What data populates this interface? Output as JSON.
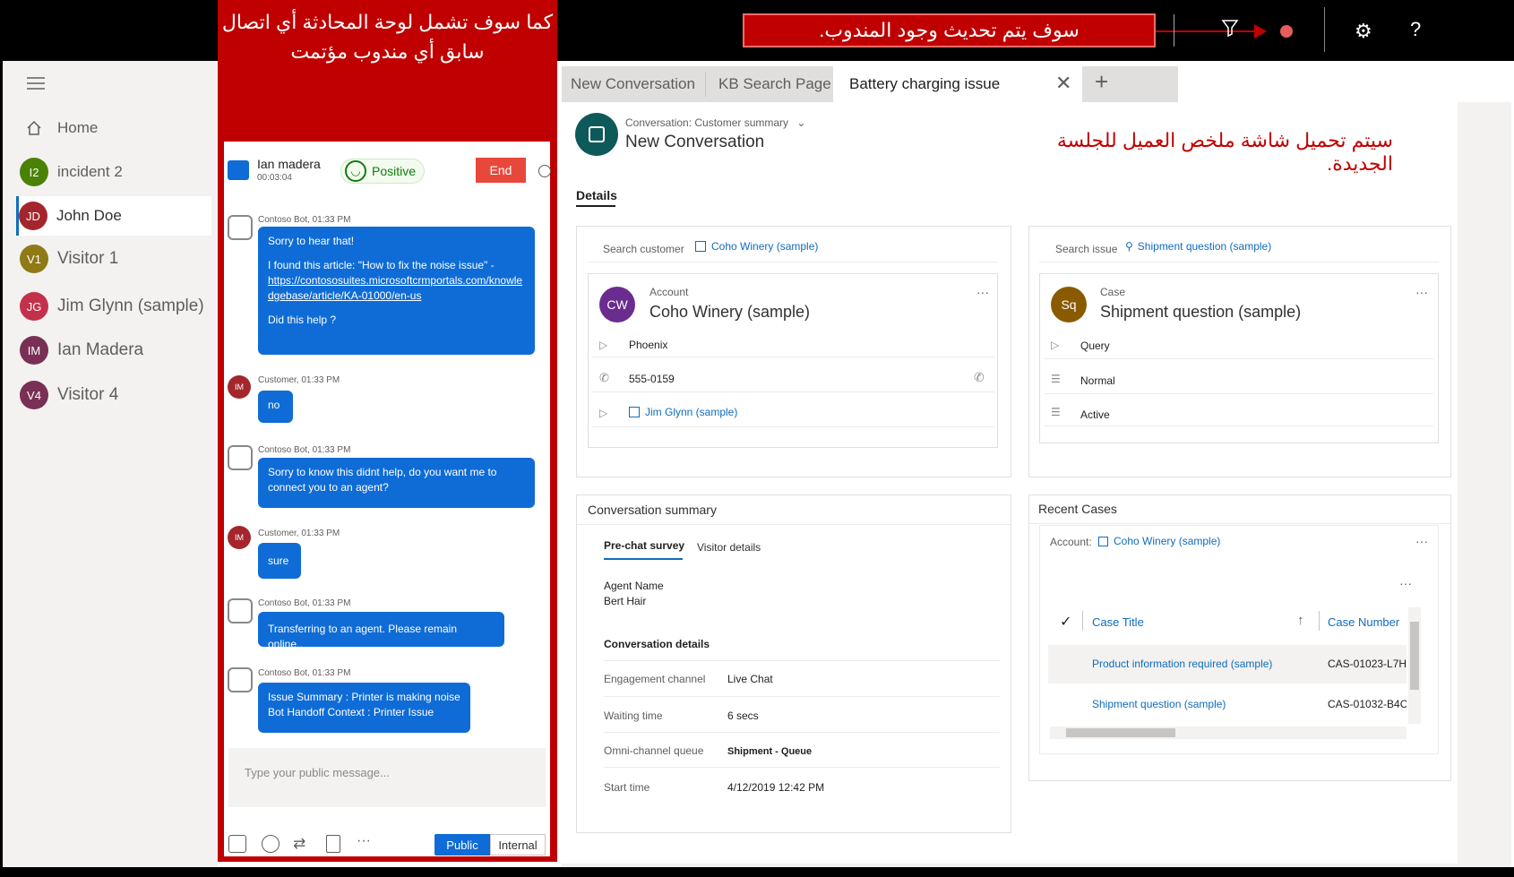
{
  "annotations": {
    "top_callout": "سوف يتم تحديث وجود المندوب.",
    "left_callout": "كما سوف تشمل لوحة المحادثة أي اتصال سابق أي مندوب مؤتمت",
    "right_callout": "سيتم تحميل شاشة ملخص العميل للجلسة الجديدة."
  },
  "topbar": {
    "settings_icon": "gear-icon",
    "help_label": "?",
    "colors": {
      "presence": "#e85b5b",
      "callout": "#c00000"
    }
  },
  "sidebar": {
    "items": [
      {
        "label": "Home",
        "icon": "home-icon"
      },
      {
        "label": "incident 2",
        "initials": "I2",
        "color": "#498205"
      },
      {
        "label": "John Doe",
        "initials": "JD",
        "color": "#a4262c"
      },
      {
        "label": "Visitor 1",
        "initials": "V1",
        "color": "#8f7a16"
      },
      {
        "label": "Jim Glynn (sample)",
        "initials": "JG",
        "color": "#c4314b"
      },
      {
        "label": "Ian Madera",
        "initials": "IM",
        "color": "#7a2f55"
      },
      {
        "label": "Visitor 4",
        "initials": "V4",
        "color": "#7a2f55"
      }
    ]
  },
  "chat": {
    "contact_name": "Ian madera",
    "duration": "00:03:04",
    "sentiment": "Positive",
    "end_label": "End",
    "messages": [
      {
        "meta": "Contoso Bot, 01:33 PM",
        "line1": "Sorry to hear that!",
        "line2": "I found this article: \"How to fix the noise issue\" -",
        "link": "https://contososuites.microsoftcrmportals.com/knowledgebase/article/KA-01000/en-us",
        "line3": "Did this help ?"
      },
      {
        "meta": "Customer, 01:33 PM",
        "text": "no",
        "initials": "IM"
      },
      {
        "meta": "Contoso Bot, 01:33 PM",
        "text": "Sorry to know this didnt help, do you want me to connect you to an agent?"
      },
      {
        "meta": "Customer, 01:33 PM",
        "text": "sure",
        "initials": "IM"
      },
      {
        "meta": "Contoso Bot, 01:33 PM",
        "text": "Transferring to an agent. Please remain online.."
      },
      {
        "meta": "Contoso Bot, 01:33 PM",
        "line1": "Issue Summary : Printer is making noise",
        "line2": "Bot Handoff Context : Printer Issue"
      }
    ],
    "compose_placeholder": "Type your public message...",
    "public_label": "Public",
    "internal_label": "Internal",
    "more_label": "···"
  },
  "tabs": [
    {
      "label": "New Conversation"
    },
    {
      "label": "KB Search Page"
    },
    {
      "label": "Battery charging issue",
      "active": true
    }
  ],
  "header": {
    "form_label": "Conversation: Customer summary",
    "title": "New Conversation",
    "details_tab": "Details"
  },
  "customer_card": {
    "search_label": "Search customer",
    "search_value": "Coho Winery (sample)",
    "type": "Account",
    "initials": "CW",
    "name": "Coho Winery (sample)",
    "city": "Phoenix",
    "phone": "555-0159",
    "contact": "Jim Glynn (sample)",
    "more": "···",
    "avatar_color": "#6b2c8f"
  },
  "case_card": {
    "search_label": "Search issue",
    "search_value": "Shipment question (sample)",
    "type": "Case",
    "initials": "Sq",
    "name": "Shipment question (sample)",
    "f1": "Query",
    "f2": "Normal",
    "f3": "Active",
    "more": "···",
    "avatar_color": "#8a5a00"
  },
  "summary": {
    "title": "Conversation summary",
    "tab1": "Pre-chat survey",
    "tab2": "Visitor details",
    "agent_label": "Agent Name",
    "agent_value": "Bert Hair",
    "details_heading": "Conversation details",
    "rows": [
      {
        "label": "Engagement channel",
        "value": "Live Chat"
      },
      {
        "label": "Waiting time",
        "value": "6 secs"
      },
      {
        "label": "Omni-channel queue",
        "value": "Shipment - Queue"
      },
      {
        "label": "Start time",
        "value": "4/12/2019 12:42 PM"
      }
    ]
  },
  "recent_cases": {
    "title": "Recent Cases",
    "account_label": "Account:",
    "account_value": "Coho Winery (sample)",
    "col_title": "Case Title",
    "col_number": "Case Number",
    "rows": [
      {
        "title": "Product information required (sample)",
        "number": "CAS-01023-L7H"
      },
      {
        "title": "Shipment question (sample)",
        "number": "CAS-01032-B4C"
      }
    ],
    "more": "···"
  }
}
